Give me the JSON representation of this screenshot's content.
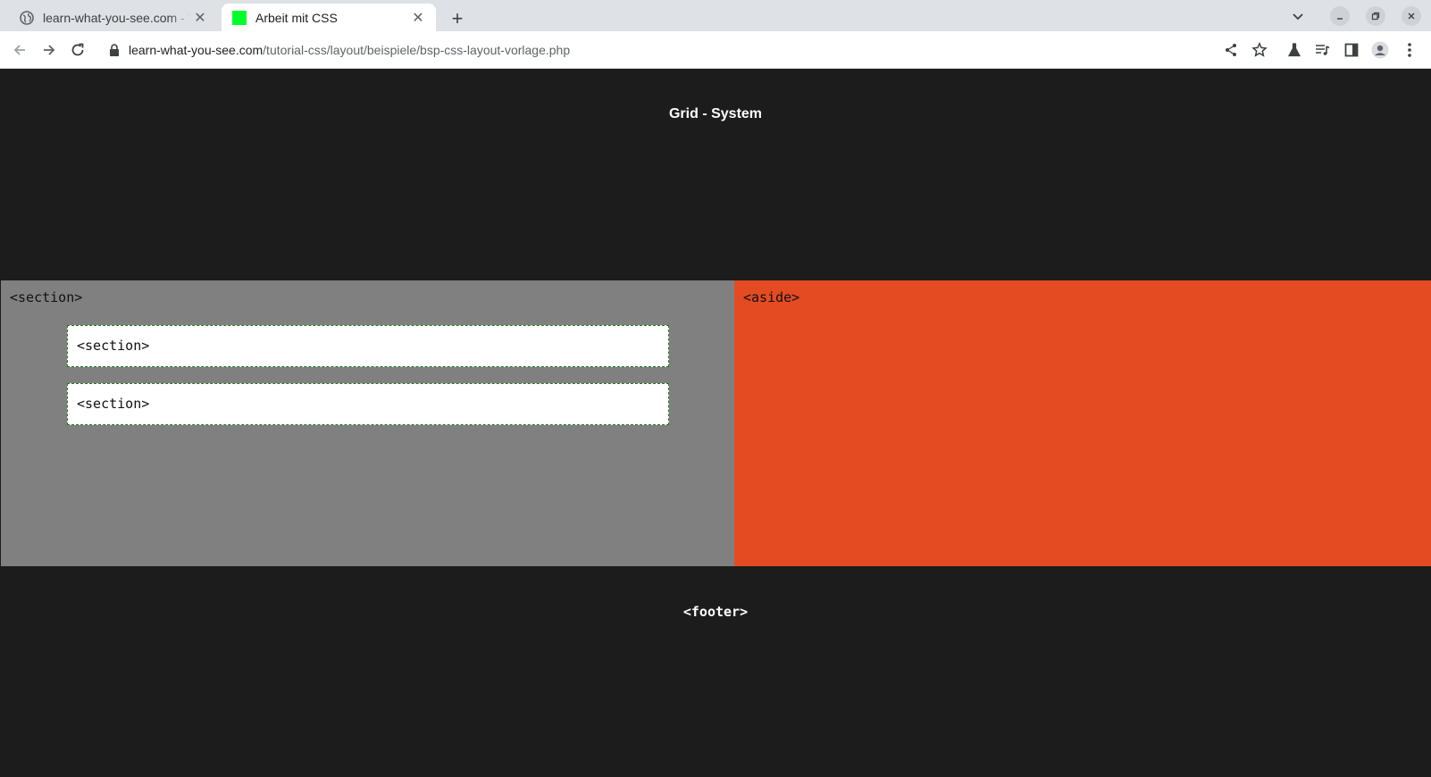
{
  "browser": {
    "tabs": [
      {
        "title": "learn-what-you-see.com - Tutorial CSS",
        "favicon": "globe-icon",
        "active": false
      },
      {
        "title": "Arbeit mit CSS",
        "favicon": "green-square-icon",
        "active": true
      }
    ],
    "address": {
      "host": "learn-what-you-see.com",
      "path": "/tutorial-css/layout/beispiele/bsp-css-layout-vorlage.php"
    }
  },
  "page": {
    "header_title": "Grid - System",
    "main_label": "<section>",
    "sub_sections": [
      "<section>",
      "<section>"
    ],
    "aside_label": "<aside>",
    "footer_label": "<footer>"
  },
  "colors": {
    "page_background": "#1c1c1c",
    "section_background": "#808080",
    "aside_background": "#e44b23",
    "sub_section_background": "#ffffff",
    "sub_section_border": "#1f7a1f",
    "favicon_green": "#00ff2a"
  }
}
